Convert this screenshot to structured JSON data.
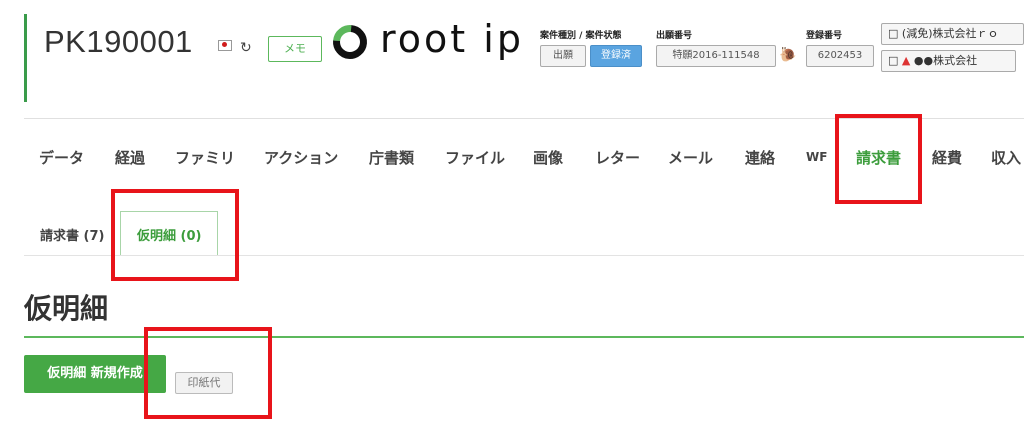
{
  "header": {
    "case_number": "PK190001",
    "country_flag_icon": "japan-flag-icon",
    "memo_label": "メモ",
    "logo_text": "root ip",
    "case_type_status_label": "案件種別 / 案件状態",
    "case_type": "出願",
    "case_status": "登録済",
    "application_no_label": "出願番号",
    "application_no": "特願2016-111548",
    "registration_no_label": "登録番号",
    "registration_no": "6202453",
    "owner_1": "(減免)株式会社ｒｏ",
    "owner_2": "●●株式会社"
  },
  "tabs": [
    {
      "label": "データ"
    },
    {
      "label": "経過"
    },
    {
      "label": "ファミリ"
    },
    {
      "label": "アクション"
    },
    {
      "label": "庁書類"
    },
    {
      "label": "ファイル"
    },
    {
      "label": "画像"
    },
    {
      "label": "レター"
    },
    {
      "label": "メール"
    },
    {
      "label": "連絡"
    },
    {
      "label": "WF"
    },
    {
      "label": "請求書",
      "active": true
    },
    {
      "label": "経費"
    },
    {
      "label": "収入"
    }
  ],
  "subtabs": [
    {
      "label": "請求書 (7)"
    },
    {
      "label": "仮明細 (0)",
      "active": true
    }
  ],
  "section": {
    "title": "仮明細",
    "new_button_label": "仮明細 新規作成",
    "stamp_button_label": "印紙代"
  },
  "colors": {
    "accent_green": "#45a845",
    "highlight_red": "#e8141a",
    "status_blue": "#5aa4e0"
  }
}
